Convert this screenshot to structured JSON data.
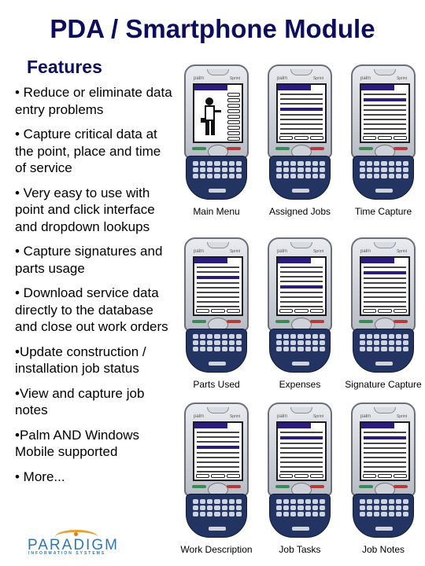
{
  "header": {
    "title": "PDA / Smartphone Module",
    "subtitle": "Features"
  },
  "features": [
    "•  Reduce or eliminate data entry problems",
    "• Capture critical data at the point, place and time of service",
    "• Very easy to use with point and click interface and dropdown lookups",
    "•  Capture signatures and parts usage",
    "• Download service data directly to the database and close out work orders",
    "•Update construction / installation job status",
    "•View and capture job notes",
    "•Palm AND Windows Mobile supported",
    "• More..."
  ],
  "logo": {
    "name": "PARADIGM",
    "tagline": "INFORMATION SYSTEMS"
  },
  "phone": {
    "brand": "palm",
    "carrier": "Sprint",
    "screen_color": "#2b1b7a",
    "body_color": "#233463"
  },
  "screenshots": [
    {
      "caption": "Main Menu"
    },
    {
      "caption": "Assigned Jobs"
    },
    {
      "caption": "Time Capture"
    },
    {
      "caption": "Parts Used"
    },
    {
      "caption": "Expenses"
    },
    {
      "caption": "Signature Capture"
    },
    {
      "caption": "Work Description"
    },
    {
      "caption": "Job Tasks"
    },
    {
      "caption": "Job Notes"
    }
  ]
}
